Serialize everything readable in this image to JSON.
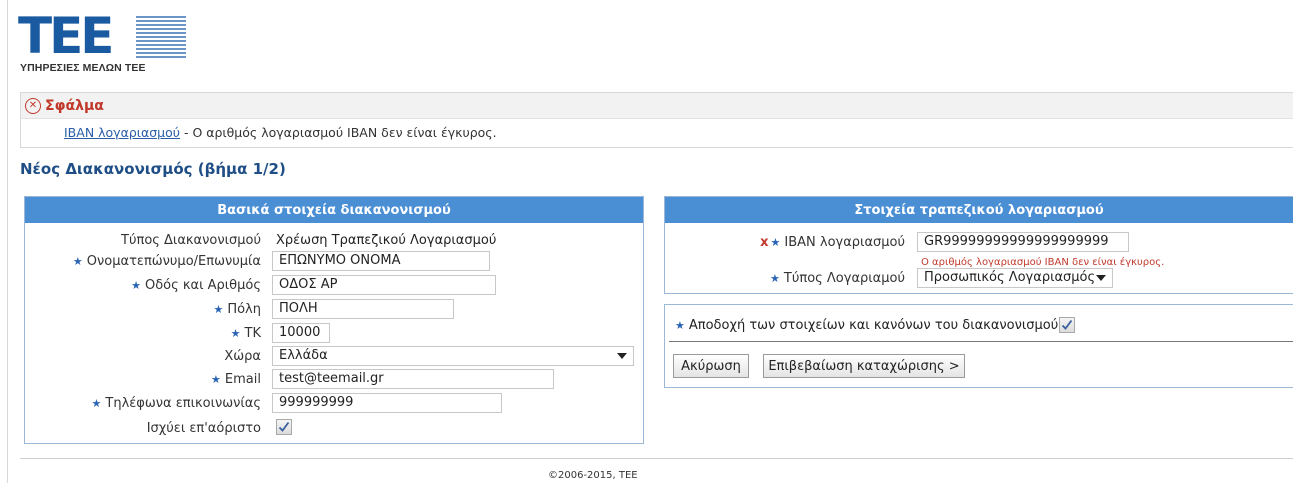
{
  "header": {
    "logo_text": "TEE",
    "logo_subtitle": "ΥΠΗΡΕΣΙΕΣ ΜΕΛΩΝ ΤΕΕ"
  },
  "error": {
    "title": "Σφάλμα",
    "field_link": "IBAN λογαριασμού",
    "message": " - Ο αριθμός λογαριασμού IBAN δεν είναι έγκυρος.",
    "icon": "error-circle-x-icon"
  },
  "page": {
    "title": "Νέος Διακανονισμός (βήμα 1/2)"
  },
  "basic": {
    "title": "Βασικά στοιχεία διακανονισμού",
    "type_label": "Τύπος Διακανονισμού",
    "type_value": "Χρέωση Τραπεζικού Λογαριασμού",
    "name_label": "Ονοματεπώνυμο/Επωνυμία",
    "name_value": "ΕΠΩΝΥΜΟ ΟΝΟΜΑ",
    "street_label": "Οδός και Αριθμός",
    "street_value": "ΟΔΟΣ ΑΡ",
    "city_label": "Πόλη",
    "city_value": "ΠΟΛΗ",
    "zip_label": "ΤΚ",
    "zip_value": "10000",
    "country_label": "Χώρα",
    "country_value": "Ελλάδα",
    "email_label": "Email",
    "email_value": "test@teemail.gr",
    "phone_label": "Τηλέφωνα επικοινωνίας",
    "phone_value": "999999999",
    "indefinite_label": "Ισχύει επ'αόριστο",
    "indefinite_checked": true
  },
  "bank": {
    "title": "Στοιχεία τραπεζικού λογαριασμού",
    "iban_label": "IBAN λογαριασμού",
    "iban_value": "GR99999999999999999999",
    "iban_error": "Ο αριθμός λογαριασμού IBAN δεν είναι έγκυρος.",
    "account_type_label": "Τύπος Λογαριαμού",
    "account_type_value": "Προσωπικός Λογαριασμός"
  },
  "accept": {
    "label": "Αποδοχή των στοιχείων και κανόνων του διακανονισμού",
    "checked": true,
    "cancel_button": "Ακύρωση",
    "confirm_button": "Επιβεβαίωση καταχώρισης >"
  },
  "footer": {
    "copyright": "©2006-2015, TEE"
  },
  "colors": {
    "panel_header": "#4a8ed4",
    "error_red": "#c0392b",
    "title_blue": "#1f4e86",
    "required_star": "#2a64b4"
  }
}
